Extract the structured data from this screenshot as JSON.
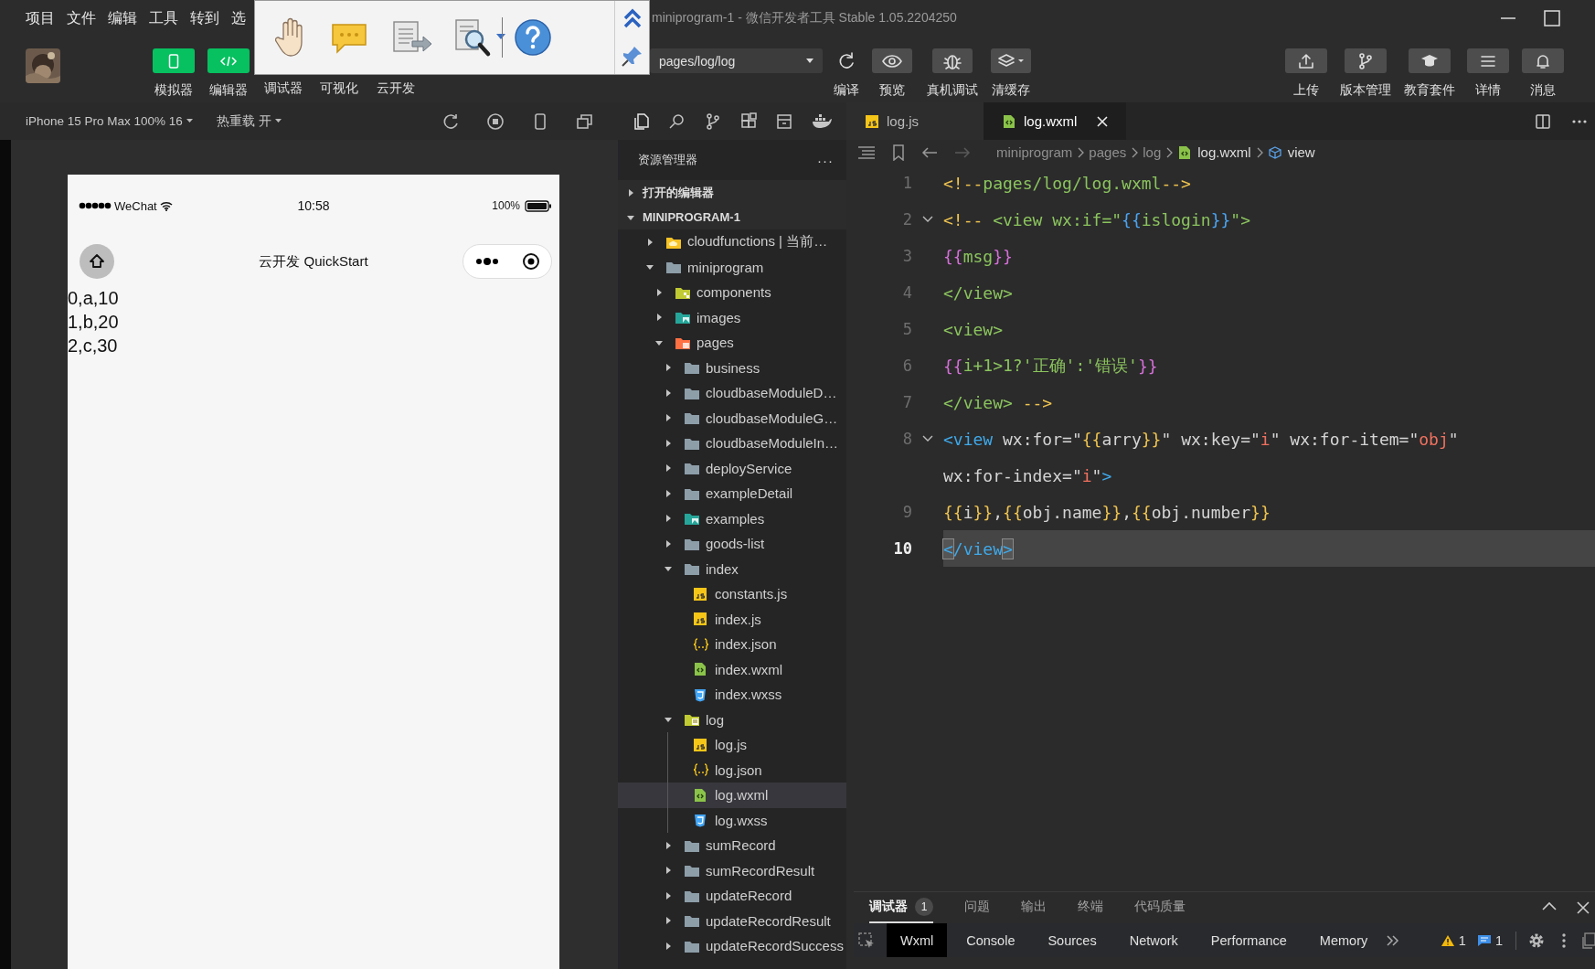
{
  "menu": [
    {
      "label": "项目"
    },
    {
      "label": "文件"
    },
    {
      "label": "编辑"
    },
    {
      "label": "工具"
    },
    {
      "label": "转到"
    },
    {
      "label": "选"
    }
  ],
  "window": {
    "title": "miniprogram-1",
    "subtitle": "- 微信开发者工具 Stable 1.05.2204250"
  },
  "view_buttons": [
    {
      "label": "模拟器",
      "kind": "phone"
    },
    {
      "label": "编辑器",
      "kind": "code"
    },
    {
      "label": "调试器",
      "kind": "hidden"
    },
    {
      "label": "可视化",
      "kind": "hidden"
    },
    {
      "label": "云开发",
      "kind": "hidden"
    }
  ],
  "compile": {
    "page": "pages/log/log"
  },
  "actions": [
    {
      "label": "编译",
      "kind": "refresh"
    },
    {
      "label": "预览",
      "kind": "eye"
    },
    {
      "label": "真机调试",
      "kind": "bug"
    },
    {
      "label": "清缓存",
      "kind": "layers"
    }
  ],
  "right_actions": [
    {
      "label": "上传",
      "kind": "upload"
    },
    {
      "label": "版本管理",
      "kind": "branch"
    },
    {
      "label": "教育套件",
      "kind": "cap"
    },
    {
      "label": "详情",
      "kind": "menu"
    },
    {
      "label": "消息",
      "kind": "bell"
    }
  ],
  "simulator": {
    "device": "iPhone 15 Pro Max 100% 16",
    "hot_reload": "热重载 开",
    "carrier": "WeChat",
    "time": "10:58",
    "battery": "100%",
    "nav_title": "云开发 QuickStart",
    "lines": [
      "0,a,10",
      "1,b,20",
      "2,c,30"
    ]
  },
  "explorer": {
    "title": "资源管理器",
    "more": "···",
    "sections": [
      {
        "label": "打开的编辑器",
        "expanded": false
      },
      {
        "label": "MINIPROGRAM-1",
        "expanded": true
      }
    ],
    "tree": [
      {
        "label": "cloudfunctions | 当前…",
        "kind": "cloud-folder",
        "expanded": false,
        "selected": false
      },
      {
        "label": "miniprogram",
        "kind": "folder",
        "expanded": true,
        "selected": false,
        "children": [
          {
            "label": "components",
            "kind": "components-folder",
            "expanded": false,
            "selected": false
          },
          {
            "label": "images",
            "kind": "images-folder",
            "expanded": false,
            "selected": false
          },
          {
            "label": "pages",
            "kind": "pages-folder",
            "expanded": true,
            "selected": false,
            "children": [
              {
                "label": "business",
                "kind": "folder",
                "expanded": false,
                "selected": false
              },
              {
                "label": "cloudbaseModuleD…",
                "kind": "folder",
                "expanded": false,
                "selected": false
              },
              {
                "label": "cloudbaseModuleG…",
                "kind": "folder",
                "expanded": false,
                "selected": false
              },
              {
                "label": "cloudbaseModuleIn…",
                "kind": "folder",
                "expanded": false,
                "selected": false
              },
              {
                "label": "deployService",
                "kind": "folder",
                "expanded": false,
                "selected": false
              },
              {
                "label": "exampleDetail",
                "kind": "folder",
                "expanded": false,
                "selected": false
              },
              {
                "label": "examples",
                "kind": "images-folder",
                "expanded": false,
                "selected": false
              },
              {
                "label": "goods-list",
                "kind": "folder",
                "expanded": false,
                "selected": false
              },
              {
                "label": "index",
                "kind": "folder",
                "expanded": true,
                "selected": false,
                "children": [
                  {
                    "label": "constants.js",
                    "kind": "js",
                    "selected": false
                  },
                  {
                    "label": "index.js",
                    "kind": "js",
                    "selected": false
                  },
                  {
                    "label": "index.json",
                    "kind": "json",
                    "selected": false
                  },
                  {
                    "label": "index.wxml",
                    "kind": "wxml",
                    "selected": false
                  },
                  {
                    "label": "index.wxss",
                    "kind": "wxss",
                    "selected": false
                  }
                ]
              },
              {
                "label": "log",
                "kind": "log-folder",
                "expanded": true,
                "selected": false,
                "children": [
                  {
                    "label": "log.js",
                    "kind": "js",
                    "selected": false
                  },
                  {
                    "label": "log.json",
                    "kind": "json",
                    "selected": false
                  },
                  {
                    "label": "log.wxml",
                    "kind": "wxml",
                    "selected": true
                  },
                  {
                    "label": "log.wxss",
                    "kind": "wxss",
                    "selected": false
                  }
                ]
              },
              {
                "label": "sumRecord",
                "kind": "folder",
                "expanded": false,
                "selected": false
              },
              {
                "label": "sumRecordResult",
                "kind": "folder",
                "expanded": false,
                "selected": false
              },
              {
                "label": "updateRecord",
                "kind": "folder",
                "expanded": false,
                "selected": false
              },
              {
                "label": "updateRecordResult",
                "kind": "folder",
                "expanded": false,
                "selected": false
              },
              {
                "label": "updateRecordSuccess",
                "kind": "folder",
                "expanded": false,
                "selected": false
              }
            ]
          }
        ]
      }
    ]
  },
  "editor": {
    "tabs": [
      {
        "label": "log.js",
        "kind": "js",
        "selected": false
      },
      {
        "label": "log.wxml",
        "kind": "wxml",
        "selected": true
      }
    ],
    "breadcrumb": [
      {
        "label": "miniprogram",
        "kind": "folder"
      },
      {
        "label": "pages",
        "kind": "folder"
      },
      {
        "label": "log",
        "kind": "folder"
      },
      {
        "label": "log.wxml",
        "kind": "wxml"
      },
      {
        "label": "view",
        "kind": "element"
      }
    ],
    "lines": [
      {
        "number": "1",
        "foldable": false,
        "current": false,
        "tokens": [
          {
            "kind": "delim",
            "text": "<!--"
          },
          {
            "kind": "comment",
            "text": "pages/log/log.wxml"
          },
          {
            "kind": "delim",
            "text": "-->"
          }
        ]
      },
      {
        "number": "2",
        "foldable": true,
        "current": false,
        "tokens": [
          {
            "kind": "delim",
            "text": "<!--"
          },
          {
            "kind": "comment",
            "text": " <view wx:if=\""
          },
          {
            "kind": "brace3",
            "text": "{{"
          },
          {
            "kind": "comment",
            "text": "islogin"
          },
          {
            "kind": "brace3",
            "text": "}}"
          },
          {
            "kind": "comment",
            "text": "\">"
          }
        ]
      },
      {
        "number": "3",
        "foldable": false,
        "current": false,
        "tokens": [
          {
            "kind": "brace2",
            "text": "{{"
          },
          {
            "kind": "comment",
            "text": "msg"
          },
          {
            "kind": "brace2",
            "text": "}}"
          }
        ]
      },
      {
        "number": "4",
        "foldable": false,
        "current": false,
        "tokens": [
          {
            "kind": "comment",
            "text": "</view>"
          }
        ]
      },
      {
        "number": "5",
        "foldable": false,
        "current": false,
        "tokens": [
          {
            "kind": "comment",
            "text": "<view>"
          }
        ]
      },
      {
        "number": "6",
        "foldable": false,
        "current": false,
        "tokens": [
          {
            "kind": "brace2",
            "text": "{{"
          },
          {
            "kind": "comment",
            "text": "i+1>1?'正确':'错误'"
          },
          {
            "kind": "brace2",
            "text": "}}"
          }
        ]
      },
      {
        "number": "7",
        "foldable": false,
        "current": false,
        "tokens": [
          {
            "kind": "comment",
            "text": "</view>"
          },
          {
            "kind": "delim",
            "text": " -->"
          }
        ]
      },
      {
        "number": "8",
        "foldable": true,
        "current": false,
        "tokens": [
          {
            "kind": "tag",
            "text": "<view"
          },
          {
            "kind": "attr",
            "text": " wx:for=\""
          },
          {
            "kind": "delim",
            "text": "{{"
          },
          {
            "kind": "attr",
            "text": "arry"
          },
          {
            "kind": "delim",
            "text": "}}"
          },
          {
            "kind": "attr",
            "text": "\" wx:key=\""
          },
          {
            "kind": "value",
            "text": "i"
          },
          {
            "kind": "attr",
            "text": "\" wx:for-item=\""
          },
          {
            "kind": "value",
            "text": "obj"
          },
          {
            "kind": "attr",
            "text": "\""
          }
        ]
      },
      {
        "tokens": [
          {
            "kind": "attr",
            "text": "wx:for-index=\""
          },
          {
            "kind": "value",
            "text": "i"
          },
          {
            "kind": "attr",
            "text": "\""
          },
          {
            "kind": "tag",
            "text": ">"
          }
        ]
      },
      {
        "number": "9",
        "foldable": false,
        "current": false,
        "tokens": [
          {
            "kind": "delim",
            "text": "{{"
          },
          {
            "kind": "attr",
            "text": "i"
          },
          {
            "kind": "delim",
            "text": "}}"
          },
          {
            "kind": "attr",
            "text": ","
          },
          {
            "kind": "delim",
            "text": "{{"
          },
          {
            "kind": "attr",
            "text": "obj.name"
          },
          {
            "kind": "delim",
            "text": "}}"
          },
          {
            "kind": "attr",
            "text": ","
          },
          {
            "kind": "delim",
            "text": "{{"
          },
          {
            "kind": "attr",
            "text": "obj.number"
          },
          {
            "kind": "delim",
            "text": "}}"
          }
        ]
      },
      {
        "number": "10",
        "foldable": false,
        "current": true,
        "tokens": [
          {
            "kind": "match",
            "text": "<"
          },
          {
            "kind": "tag",
            "text": "/view"
          },
          {
            "kind": "match",
            "text": ">"
          }
        ]
      }
    ]
  },
  "debugger": {
    "tabs": [
      {
        "label": "调试器",
        "badge": "1",
        "selected": true
      },
      {
        "label": "问题",
        "selected": false
      },
      {
        "label": "输出",
        "selected": false
      },
      {
        "label": "终端",
        "selected": false
      },
      {
        "label": "代码质量",
        "selected": false
      }
    ],
    "devtools_tabs": [
      {
        "label": "Wxml",
        "selected": true
      },
      {
        "label": "Console",
        "selected": false
      },
      {
        "label": "Sources",
        "selected": false
      },
      {
        "label": "Network",
        "selected": false
      },
      {
        "label": "Performance",
        "selected": false
      },
      {
        "label": "Memory",
        "selected": false
      }
    ],
    "warnings": "1",
    "messages": "1"
  }
}
